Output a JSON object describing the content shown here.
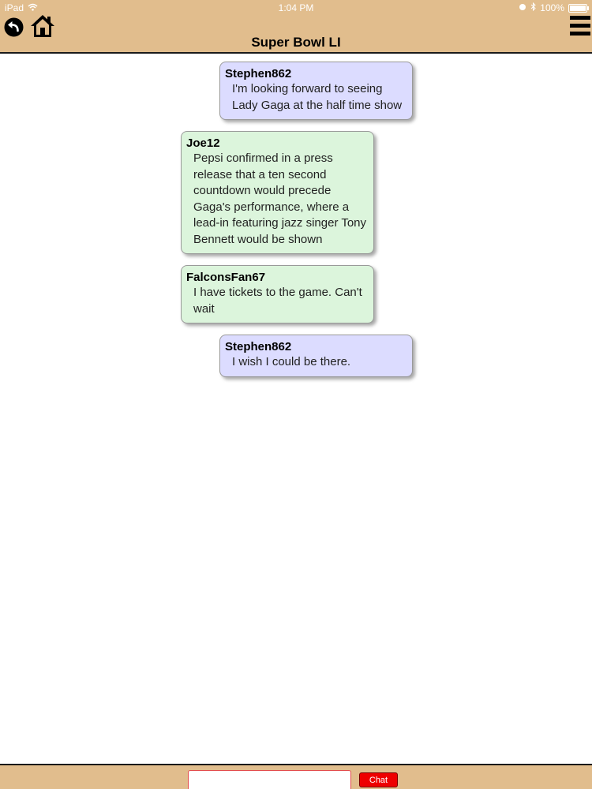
{
  "status_bar": {
    "device": "iPad",
    "time": "1:04 PM",
    "battery_percent": "100%"
  },
  "header": {
    "title": "Super Bowl LI",
    "icons": [
      "back-arrow-icon",
      "home-icon",
      "hamburger-menu-icon"
    ],
    "background_color": "#e1bd8d"
  },
  "messages": [
    {
      "user": "Stephen862",
      "text": "I'm looking forward to seeing Lady Gaga at the half time show",
      "type": "mine"
    },
    {
      "user": "Joe12",
      "text": "Pepsi confirmed in a press release that a ten second countdown would precede Gaga's performance, where a lead-in featuring jazz singer Tony Bennett would be shown",
      "type": "other"
    },
    {
      "user": "FalconsFan67",
      "text": "I have tickets to the game. Can't wait",
      "type": "other"
    },
    {
      "user": "Stephen862",
      "text": "I wish I could be there.",
      "type": "mine"
    }
  ],
  "colors": {
    "mine_bubble": "#dcdcff",
    "other_bubble": "#dcf5dc",
    "chat_button": "#ee0000"
  },
  "footer": {
    "input_value": "",
    "chat_label": "Chat"
  }
}
